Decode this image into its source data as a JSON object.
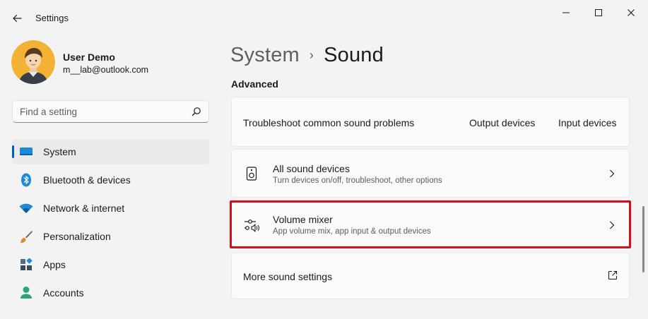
{
  "window": {
    "title": "Settings",
    "controls": [
      "minimize",
      "maximize",
      "close"
    ]
  },
  "user": {
    "name": "User Demo",
    "email": "m__lab@outlook.com"
  },
  "search": {
    "placeholder": "Find a setting"
  },
  "sidebar": {
    "items": [
      {
        "label": "System",
        "icon": "system-icon",
        "active": true
      },
      {
        "label": "Bluetooth & devices",
        "icon": "bluetooth-icon",
        "active": false
      },
      {
        "label": "Network & internet",
        "icon": "wifi-icon",
        "active": false
      },
      {
        "label": "Personalization",
        "icon": "brush-icon",
        "active": false
      },
      {
        "label": "Apps",
        "icon": "apps-icon",
        "active": false
      },
      {
        "label": "Accounts",
        "icon": "accounts-icon",
        "active": false
      }
    ]
  },
  "breadcrumb": {
    "parent": "System",
    "separator": "›",
    "current": "Sound"
  },
  "advanced": {
    "title": "Advanced",
    "troubleshoot": {
      "label": "Troubleshoot common sound problems",
      "output_button": "Output devices",
      "input_button": "Input devices"
    },
    "all_sound_devices": {
      "title": "All sound devices",
      "description": "Turn devices on/off, troubleshoot, other options"
    },
    "volume_mixer": {
      "title": "Volume mixer",
      "description": "App volume mix, app input & output devices"
    },
    "more_sound_settings": {
      "label": "More sound settings"
    }
  },
  "colors": {
    "accent": "#005fb8",
    "highlight": "#d0101b",
    "background": "#f3f3f3",
    "card": "#fbfbfb"
  }
}
